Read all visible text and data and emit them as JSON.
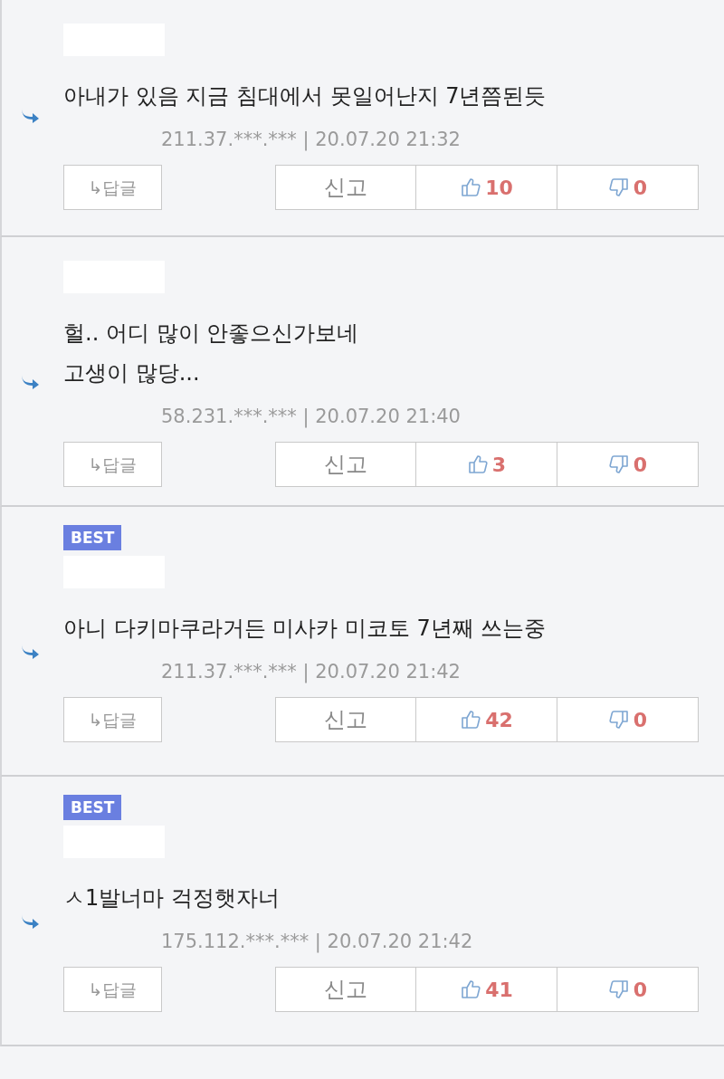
{
  "comments": [
    {
      "lines": [
        "아내가 있음 지금 침대에서 못일어난지 7년쯤된듯"
      ],
      "meta": "211.37.***.*** | 20.07.20 21:32",
      "reply": "↳답글",
      "report": "신고",
      "likes": "10",
      "dislikes": "0"
    },
    {
      "lines": [
        "헐.. 어디 많이 안좋으신가보네",
        "고생이 많당..."
      ],
      "meta": "58.231.***.*** | 20.07.20 21:40",
      "reply": "↳답글",
      "report": "신고",
      "likes": "3",
      "dislikes": "0"
    },
    {
      "badge": "BEST",
      "lines": [
        "아니 다키마쿠라거든 미사카 미코토 7년째 쓰는중"
      ],
      "meta": "211.37.***.*** | 20.07.20 21:42",
      "reply": "↳답글",
      "report": "신고",
      "likes": "42",
      "dislikes": "0"
    },
    {
      "badge": "BEST",
      "lines": [
        "ㅅ1발너마 걱정햇자너"
      ],
      "meta": "175.112.***.*** | 20.07.20 21:42",
      "reply": "↳답글",
      "report": "신고",
      "likes": "41",
      "dislikes": "0"
    }
  ]
}
